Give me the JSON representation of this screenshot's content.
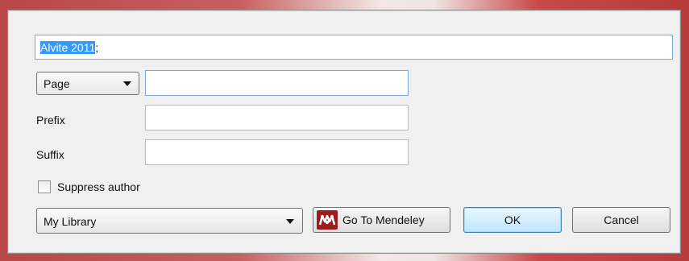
{
  "citation": {
    "selected_text": "Alvite 2011",
    "trailing_text": ";"
  },
  "locator": {
    "selected": "Page",
    "value": ""
  },
  "prefix": {
    "label": "Prefix",
    "value": ""
  },
  "suffix": {
    "label": "Suffix",
    "value": ""
  },
  "suppress_author": {
    "label": "Suppress author",
    "checked": false
  },
  "library": {
    "selected": "My Library"
  },
  "buttons": {
    "go_to_mendeley": "Go To Mendeley",
    "ok": "OK",
    "cancel": "Cancel"
  },
  "colors": {
    "selection": "#3399ff",
    "mendeley_brand": "#9b1c1c",
    "focus_border": "#7aa7d8"
  },
  "icons": {
    "mendeley": "mendeley-logo-icon",
    "dropdown": "chevron-down-icon",
    "checkbox": "checkbox-unchecked-icon"
  }
}
